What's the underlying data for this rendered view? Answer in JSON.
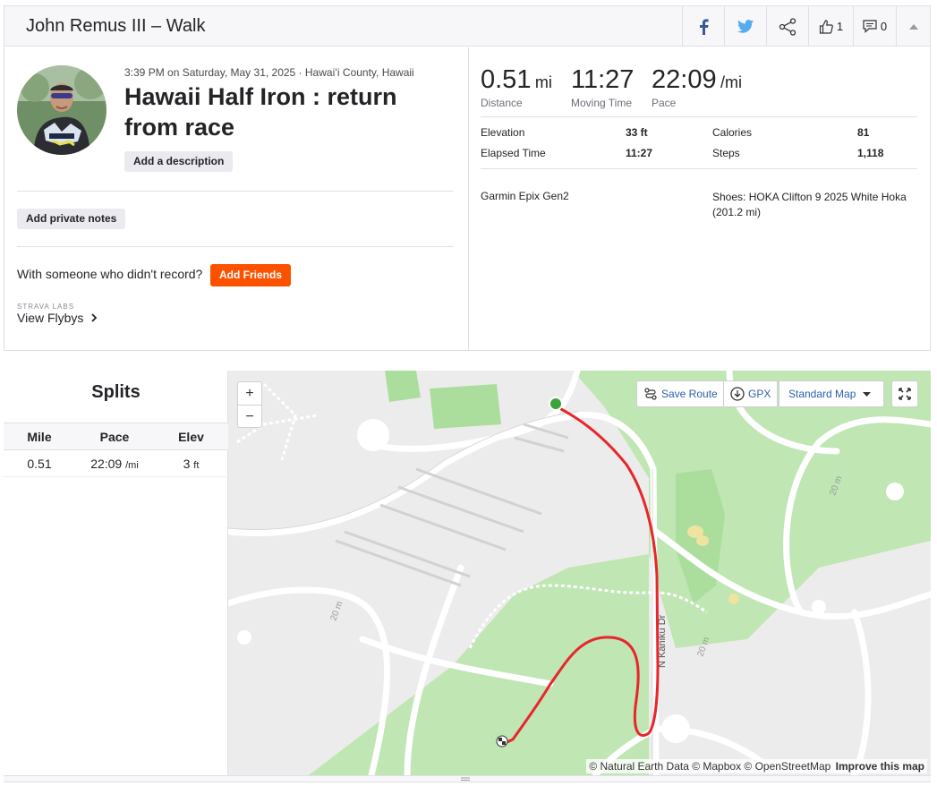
{
  "header": {
    "title": "John Remus III – Walk",
    "kudos_count": "1",
    "comment_count": "0"
  },
  "activity": {
    "meta": "3:39 PM on Saturday, May 31, 2025 · Hawaiʻi County, Hawaii",
    "title": "Hawaii Half Iron : return from race",
    "add_description": "Add a description",
    "add_private_notes": "Add private notes",
    "with_someone": "With someone who didn't record?",
    "add_friends": "Add Friends",
    "labs": "STRAVA LABS",
    "view_flybys": "View Flybys"
  },
  "stats": {
    "distance_value": "0.51",
    "distance_unit": "mi",
    "distance_label": "Distance",
    "moving_value": "11:27",
    "moving_label": "Moving Time",
    "pace_value": "22:09",
    "pace_unit": "/mi",
    "pace_label": "Pace",
    "elevation_label": "Elevation",
    "elevation_value": "33 ft",
    "calories_label": "Calories",
    "calories_value": "81",
    "elapsed_label": "Elapsed Time",
    "elapsed_value": "11:27",
    "steps_label": "Steps",
    "steps_value": "1,118",
    "device": "Garmin Epix Gen2",
    "shoes": "Shoes: HOKA Clifton 9 2025 White Hoka (201.2 mi)"
  },
  "splits": {
    "title": "Splits",
    "headers": [
      "Mile",
      "Pace",
      "Elev"
    ],
    "rows": [
      {
        "mile": "0.51",
        "pace": "22:09",
        "pace_unit": "/mi",
        "elev": "3",
        "elev_unit": "ft"
      }
    ]
  },
  "map": {
    "zoom_in": "+",
    "zoom_out": "−",
    "save_route": "Save Route",
    "gpx": "GPX",
    "map_type": "Standard Map",
    "street_label": "N Kaniku Dr",
    "contour_labels": [
      "20 m",
      "20 m",
      "20 m"
    ],
    "attribution": "© Natural Earth Data © Mapbox © OpenStreetMap",
    "improve": "Improve this map"
  },
  "colors": {
    "accent": "#fc5200",
    "route": "#e8262b",
    "start": "#3aa33a",
    "link": "#2e5fa8",
    "facebook": "#3b5998",
    "twitter": "#55acee"
  }
}
